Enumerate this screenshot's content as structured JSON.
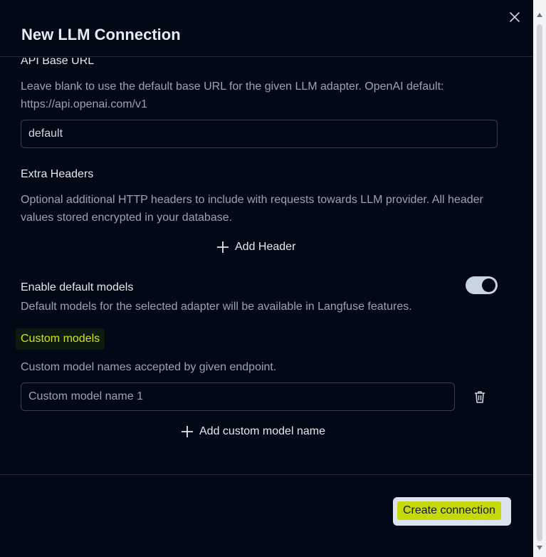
{
  "dialog": {
    "title": "New LLM Connection",
    "close_icon": "close-icon"
  },
  "api_base_url": {
    "label": "API Base URL",
    "description": "Leave blank to use the default base URL for the given LLM adapter. OpenAI default: https://api.openai.com/v1",
    "value": "default"
  },
  "extra_headers": {
    "label": "Extra Headers",
    "description": "Optional additional HTTP headers to include with requests towards LLM provider. All header values stored encrypted in your database.",
    "add_label": "Add Header",
    "add_icon": "plus-icon"
  },
  "default_models": {
    "label": "Enable default models",
    "description": "Default models for the selected adapter will be available in Langfuse features.",
    "enabled": true
  },
  "custom_models": {
    "label": "Custom models",
    "description": "Custom model names accepted by given endpoint.",
    "input_placeholder": "Custom model name 1",
    "delete_icon": "trash-icon",
    "add_label": "Add custom model name",
    "add_icon": "plus-icon"
  },
  "footer": {
    "create_label": "Create connection"
  },
  "colors": {
    "background": "#030816",
    "highlight": "#c8d90a",
    "toggle_on": "#c8d3e3"
  }
}
